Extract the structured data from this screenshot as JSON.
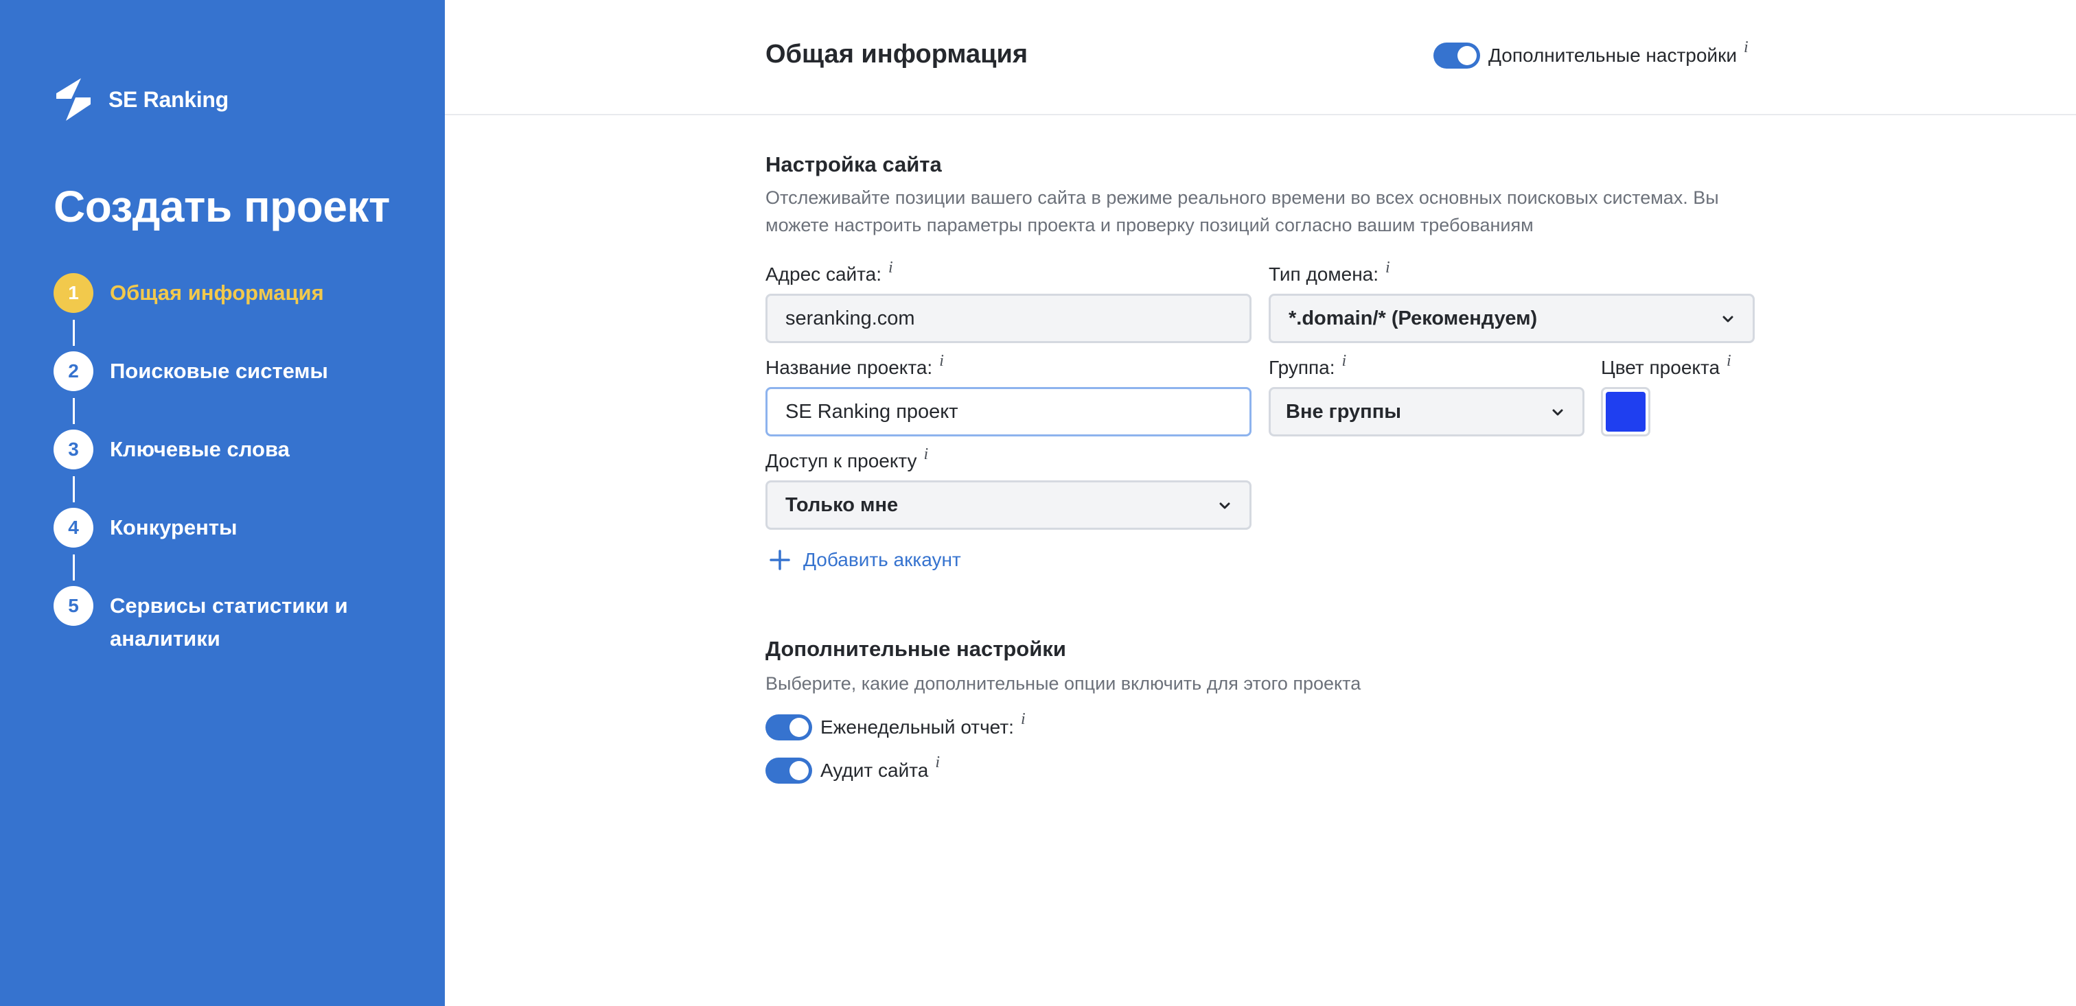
{
  "brand": {
    "name": "SE Ranking"
  },
  "sidebar": {
    "title": "Создать проект",
    "steps": [
      {
        "number": "1",
        "label": "Общая информация",
        "active": true
      },
      {
        "number": "2",
        "label": "Поисковые системы",
        "active": false
      },
      {
        "number": "3",
        "label": "Ключевые слова",
        "active": false
      },
      {
        "number": "4",
        "label": "Конкуренты",
        "active": false
      },
      {
        "number": "5",
        "label": "Сервисы статистики и аналитики",
        "active": false
      }
    ]
  },
  "header": {
    "title": "Общая информация",
    "advanced_toggle": {
      "label": "Дополнительные настройки",
      "enabled": true
    }
  },
  "info_glyph": "i",
  "site_settings": {
    "title": "Настройка сайта",
    "description": "Отслеживайте позиции вашего сайта в режиме реального времени во всех основных поисковых системах. Вы можете настроить параметры проекта и проверку позиций согласно вашим требованиям",
    "site_url": {
      "label": "Адрес сайта:",
      "value": "seranking.com"
    },
    "domain_type": {
      "label": "Тип домена:",
      "value": "*.domain/* (Рекомендуем)"
    },
    "project_name": {
      "label": "Название проекта:",
      "value": "SE Ranking проект"
    },
    "group": {
      "label": "Группа:",
      "value": "Вне группы"
    },
    "project_color": {
      "label": "Цвет проекта",
      "value": "#1f3ff0"
    },
    "access": {
      "label": "Доступ к проекту",
      "value": "Только мне"
    },
    "add_account_label": "Добавить аккаунт"
  },
  "extra_settings": {
    "title": "Дополнительные настройки",
    "description": "Выберите, какие дополнительные опции включить для этого проекта",
    "options": [
      {
        "label": "Еженедельный отчет:",
        "enabled": true
      },
      {
        "label": "Аудит сайта",
        "enabled": true
      }
    ]
  },
  "colors": {
    "sidebar_bg": "#3673cf",
    "accent": "#3673cf",
    "active_step": "#f2c94c"
  }
}
